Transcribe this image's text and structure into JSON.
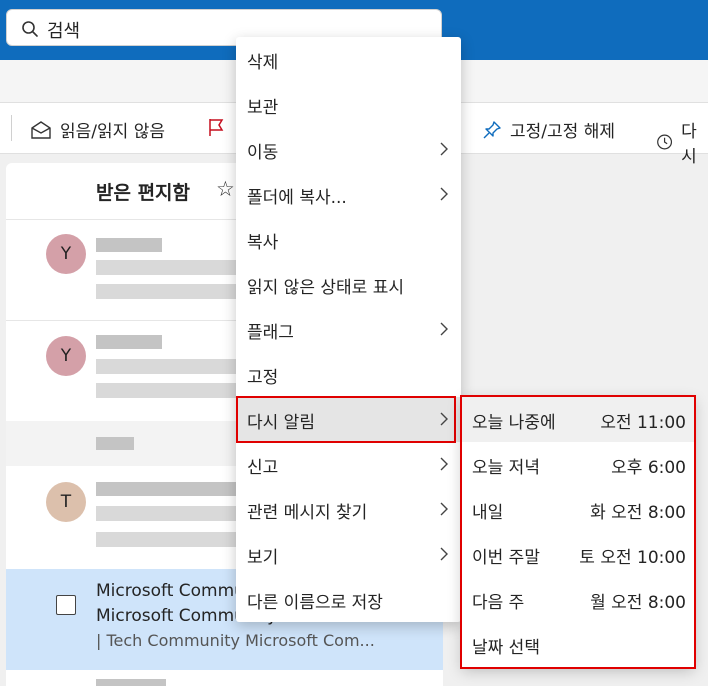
{
  "search": {
    "placeholder": "검색"
  },
  "toolbar": {
    "read_unread": "읽음/읽지 않음",
    "pin_unpin": "고정/고정 해제",
    "snooze_partial": "다시"
  },
  "mail_pane": {
    "title": "받은 편지함",
    "avatars": [
      "Y",
      "Y",
      "T"
    ],
    "selected": {
      "line1": "Microsoft Commu",
      "line2": "Microsoft Communityli...",
      "line3": "| Tech Community Microsoft Com..."
    }
  },
  "context_menu": {
    "items": [
      {
        "label": "삭제",
        "submenu": false
      },
      {
        "label": "보관",
        "submenu": false
      },
      {
        "label": "이동",
        "submenu": true
      },
      {
        "label": "폴더에 복사...",
        "submenu": true
      },
      {
        "label": "복사",
        "submenu": false
      },
      {
        "label": "읽지 않은 상태로 표시",
        "submenu": false
      },
      {
        "label": "플래그",
        "submenu": true
      },
      {
        "label": "고정",
        "submenu": false
      },
      {
        "label": "다시 알림",
        "submenu": true,
        "highlighted": true
      },
      {
        "label": "신고",
        "submenu": true
      },
      {
        "label": "관련 메시지 찾기",
        "submenu": true
      },
      {
        "label": "보기",
        "submenu": true
      },
      {
        "label": "다른 이름으로 저장",
        "submenu": false
      }
    ]
  },
  "snooze_submenu": {
    "items": [
      {
        "label": "오늘 나중에",
        "time": "오전 11:00"
      },
      {
        "label": "오늘 저녁",
        "time": "오후 6:00"
      },
      {
        "label": "내일",
        "time": "화 오전 8:00"
      },
      {
        "label": "이번 주말",
        "time": "토 오전 10:00"
      },
      {
        "label": "다음 주",
        "time": "월 오전 8:00"
      },
      {
        "label": "날짜 선택",
        "time": ""
      }
    ]
  },
  "colors": {
    "topbar": "#0f6cbd",
    "highlight_border": "#e00000",
    "selected_row": "#cfe4fa",
    "avatar_y": "#d4a0a8",
    "avatar_t": "#dcc0ac",
    "flag_icon": "#c50f1f",
    "pin_icon": "#0f6cbd"
  }
}
